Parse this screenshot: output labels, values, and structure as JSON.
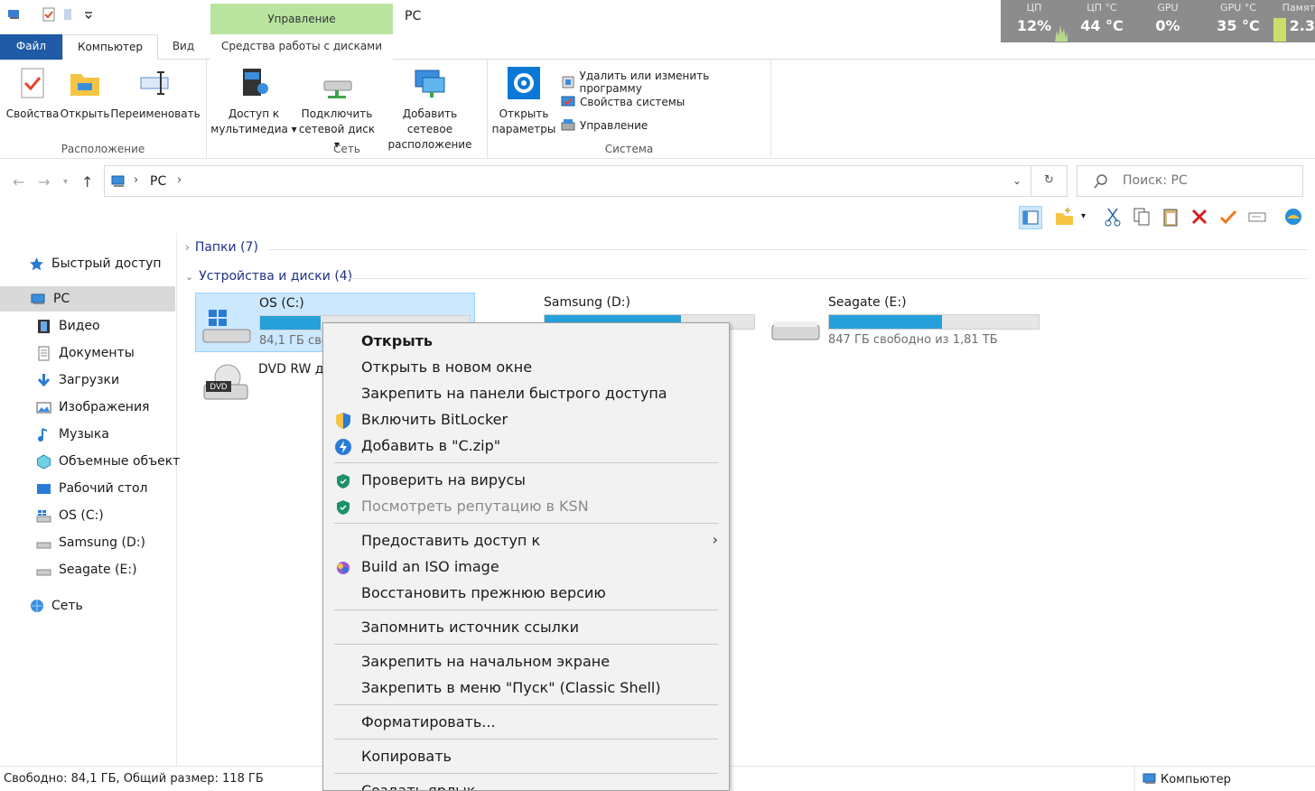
{
  "window": {
    "title": "PC",
    "context_tab_header": "Управление"
  },
  "perf": {
    "cpu_label": "ЦП",
    "cpu_value": "12%",
    "cpu_temp_label": "ЦП °C",
    "cpu_temp_value": "44 °C",
    "gpu_label": "GPU",
    "gpu_value": "0%",
    "gpu_temp_label": "GPU °C",
    "gpu_temp_value": "35 °C",
    "mem_label": "Памят",
    "mem_value": "2.3"
  },
  "tabs": {
    "file": "Файл",
    "computer": "Компьютер",
    "view": "Вид",
    "drive_tools": "Средства работы с дисками"
  },
  "ribbon": {
    "location": {
      "label": "Расположение",
      "properties": "Свойства",
      "open": "Открыть",
      "rename": "Переименовать"
    },
    "network": {
      "label": "Сеть",
      "media_line1": "Доступ к",
      "media_line2": "мультимедиа",
      "map_line1": "Подключить",
      "map_line2": "сетевой диск",
      "add_line1": "Добавить сетевое",
      "add_line2": "расположение"
    },
    "system": {
      "label": "Система",
      "open_line1": "Открыть",
      "open_line2": "параметры",
      "uninstall": "Удалить или изменить программу",
      "sys_props": "Свойства системы",
      "manage": "Управление"
    }
  },
  "address": {
    "crumb": "PC",
    "search_placeholder": "Поиск: PC"
  },
  "nav": {
    "quick_access": "Быстрый доступ",
    "pc": "PC",
    "video": "Видео",
    "documents": "Документы",
    "downloads": "Загрузки",
    "pictures": "Изображения",
    "music": "Музыка",
    "objects3d": "Объемные объект",
    "desktop": "Рабочий стол",
    "drive_c": "OS (C:)",
    "drive_d": "Samsung (D:)",
    "drive_e": "Seagate (E:)",
    "network": "Сеть"
  },
  "content": {
    "folders_header": "Папки (7)",
    "devices_header": "Устройства и диски (4)",
    "drives": [
      {
        "name": "OS (C:)",
        "free_text": "84,1 ГБ своб",
        "used_fraction": 0.29
      },
      {
        "name": "Samsung (D:)",
        "free_text": "",
        "used_fraction": 0.65
      },
      {
        "name": "Seagate (E:)",
        "free_text": "847 ГБ свободно из 1,81 ТБ",
        "used_fraction": 0.54
      },
      {
        "name": "DVD RW д",
        "free_text": ""
      }
    ]
  },
  "context_menu": {
    "open": "Открыть",
    "open_new_window": "Открыть в новом окне",
    "pin_quick": "Закрепить на панели быстрого доступа",
    "bitlocker": "Включить BitLocker",
    "add_zip": "Добавить в \"C.zip\"",
    "scan": "Проверить на вирусы",
    "ksn": "Посмотреть репутацию в KSN",
    "share": "Предоставить доступ к",
    "iso": "Build an ISO image",
    "restore": "Восстановить прежнюю версию",
    "remember_link": "Запомнить источник ссылки",
    "pin_start": "Закрепить на начальном экране",
    "pin_classic": "Закрепить в меню \"Пуск\" (Classic Shell)",
    "format": "Форматировать...",
    "copy": "Копировать",
    "shortcut": "Создать ярлык"
  },
  "status": {
    "text": "Свободно: 84,1 ГБ, Общий размер: 118 ГБ",
    "location": "Компьютер"
  },
  "colors": {
    "accent": "#1f5ba6",
    "context_tab": "#b9e4a0",
    "selection": "#cce8ff",
    "drive_bar": "#26a0da"
  }
}
